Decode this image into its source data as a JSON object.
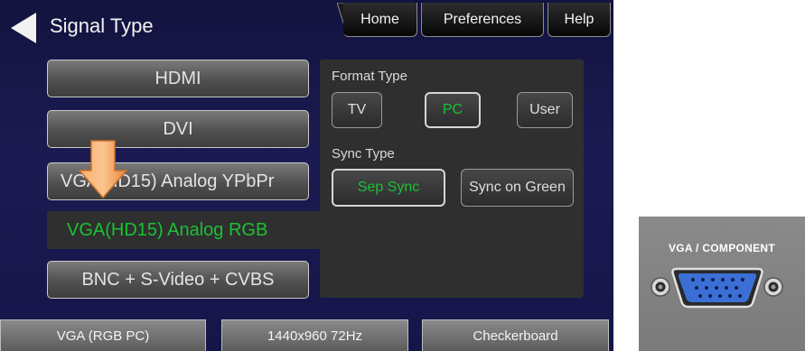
{
  "header": {
    "title": "Signal Type",
    "nav": {
      "home": "Home",
      "preferences": "Preferences",
      "help": "Help"
    }
  },
  "signal_types": {
    "hdmi": "HDMI",
    "dvi": "DVI",
    "vga_ypbpr": "VGA(HD15) Analog YPbPr",
    "vga_rgb": "VGA(HD15) Analog RGB",
    "bnc": "BNC + S-Video + CVBS",
    "selected": "VGA(HD15) Analog RGB"
  },
  "format_type": {
    "label": "Format Type",
    "options": [
      "TV",
      "PC",
      "User"
    ],
    "selected": "PC"
  },
  "sync_type": {
    "label": "Sync Type",
    "options": [
      "Sep Sync",
      "Sync on Green"
    ],
    "selected": "Sep Sync"
  },
  "status_bar": {
    "interface": "VGA (RGB PC)",
    "format": "1440x960 72Hz",
    "image": "Checkerboard"
  },
  "connector_photo": {
    "label": "VGA / COMPONENT"
  },
  "colors": {
    "selected_text": "#19c233",
    "screen_bg": "#1b1b52",
    "panel_bg": "#2f2f2f",
    "arrow": "#f29b4a",
    "connector": "#3b6fd6"
  },
  "icons": [
    "back-arrow-icon",
    "down-arrow-icon",
    "vga-port-icon",
    "screw-icon"
  ]
}
